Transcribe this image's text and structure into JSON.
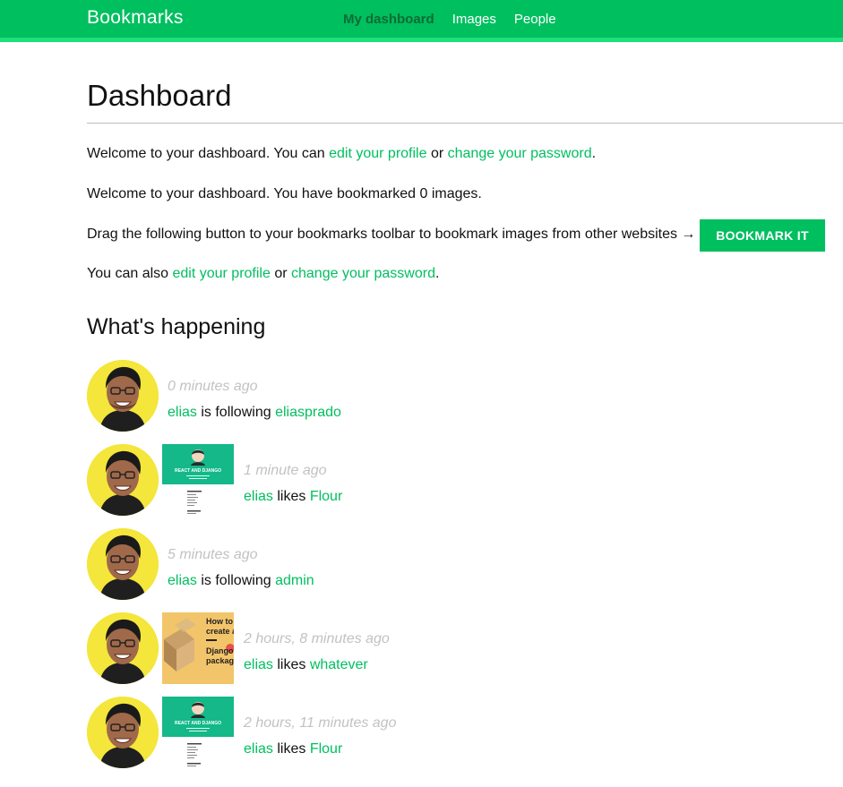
{
  "header": {
    "brand": "Bookmarks",
    "nav": [
      {
        "label": "My dashboard",
        "selected": true
      },
      {
        "label": "Images",
        "selected": false
      },
      {
        "label": "People",
        "selected": false
      }
    ]
  },
  "page": {
    "title": "Dashboard",
    "welcome1": {
      "prefix": "Welcome to your dashboard. You can ",
      "link1": "edit your profile",
      "mid": " or ",
      "link2": "change your password",
      "suffix": "."
    },
    "welcome2": "Welcome to your dashboard. You have bookmarked 0 images.",
    "drag_text": "Drag the following button to your bookmarks toolbar to bookmark images from other websites →",
    "bookmark_button": "BOOKMARK IT",
    "also": {
      "prefix": "You can also ",
      "link1": "edit your profile",
      "mid": " or ",
      "link2": "change your password",
      "suffix": "."
    },
    "feed_title": "What's happening"
  },
  "feed": [
    {
      "time": "0 minutes ago",
      "user": "elias",
      "verb": " is following ",
      "target": "eliasprado",
      "thumb": null
    },
    {
      "time": "1 minute ago",
      "user": "elias",
      "verb": " likes ",
      "target": "Flour",
      "thumb": "react-django"
    },
    {
      "time": "5 minutes ago",
      "user": "elias",
      "verb": " is following ",
      "target": "admin",
      "thumb": null
    },
    {
      "time": "2 hours, 8 minutes ago",
      "user": "elias",
      "verb": " likes ",
      "target": "whatever",
      "thumb": "django-package"
    },
    {
      "time": "2 hours, 11 minutes ago",
      "user": "elias",
      "verb": " likes ",
      "target": "Flour",
      "thumb": "react-django"
    }
  ],
  "thumb_text": {
    "react_django": "REACT AND DJANGO",
    "django_package_1": "How to",
    "django_package_2": "create a",
    "django_package_3": "Django",
    "django_package_4": "package"
  },
  "colors": {
    "accent": "#00bf5f",
    "header_stripe": "#1ee07a",
    "nav_selected": "#0e6b35",
    "avatar_bg": "#f4e63a",
    "timestamp": "#c2c2c2"
  }
}
